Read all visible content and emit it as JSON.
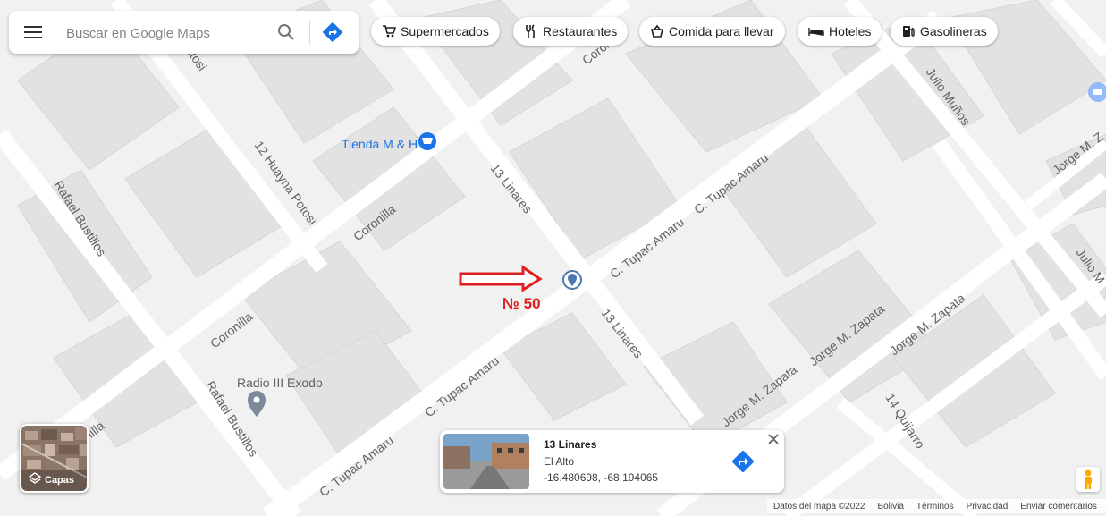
{
  "search": {
    "placeholder": "Buscar en Google Maps"
  },
  "chips": [
    {
      "label": "Supermercados",
      "icon": "cart-icon"
    },
    {
      "label": "Restaurantes",
      "icon": "fork-knife-icon"
    },
    {
      "label": "Comida para llevar",
      "icon": "takeout-icon"
    },
    {
      "label": "Hoteles",
      "icon": "bed-icon"
    },
    {
      "label": "Gasolineras",
      "icon": "gas-station-icon"
    }
  ],
  "streets": {
    "coronilla": "Coronilla",
    "coronilla_fragment": "onilla",
    "coronilla_top": "Corol",
    "tupac_amaru": "C. Tupac Amaru",
    "linares_13": "13 Linares",
    "huayna_potosi": "12 Huayna Potosi",
    "potosi_fragment": "otosi",
    "rafael_bustillos": "Rafael Bustillos",
    "jorge_zapata": "Jorge M. Zapata",
    "jorge_z_fragment": "Jorge M. Z",
    "julio_munoz": "Julio Muños",
    "julio_fragment": "Julio M",
    "quijarro": "14 Quijarro"
  },
  "places": {
    "tienda": "Tienda M & H",
    "radio": "Radio III Exodo"
  },
  "annotation": {
    "label": "№ 50",
    "color": "#e02020"
  },
  "info_card": {
    "title": "13 Linares",
    "subtitle": "El Alto",
    "coords": "-16.480698, -68.194065"
  },
  "layers": {
    "label": "Capas"
  },
  "footer": {
    "items": [
      "Datos del mapa ©2022",
      "Bolivia",
      "Términos",
      "Privacidad",
      "Enviar comentarios"
    ]
  },
  "colors": {
    "road": "#ffffff",
    "block": "#e8e8e8",
    "building": "#dcdcdc",
    "accent": "#4285f4",
    "poi_blue": "#1a73e8"
  }
}
